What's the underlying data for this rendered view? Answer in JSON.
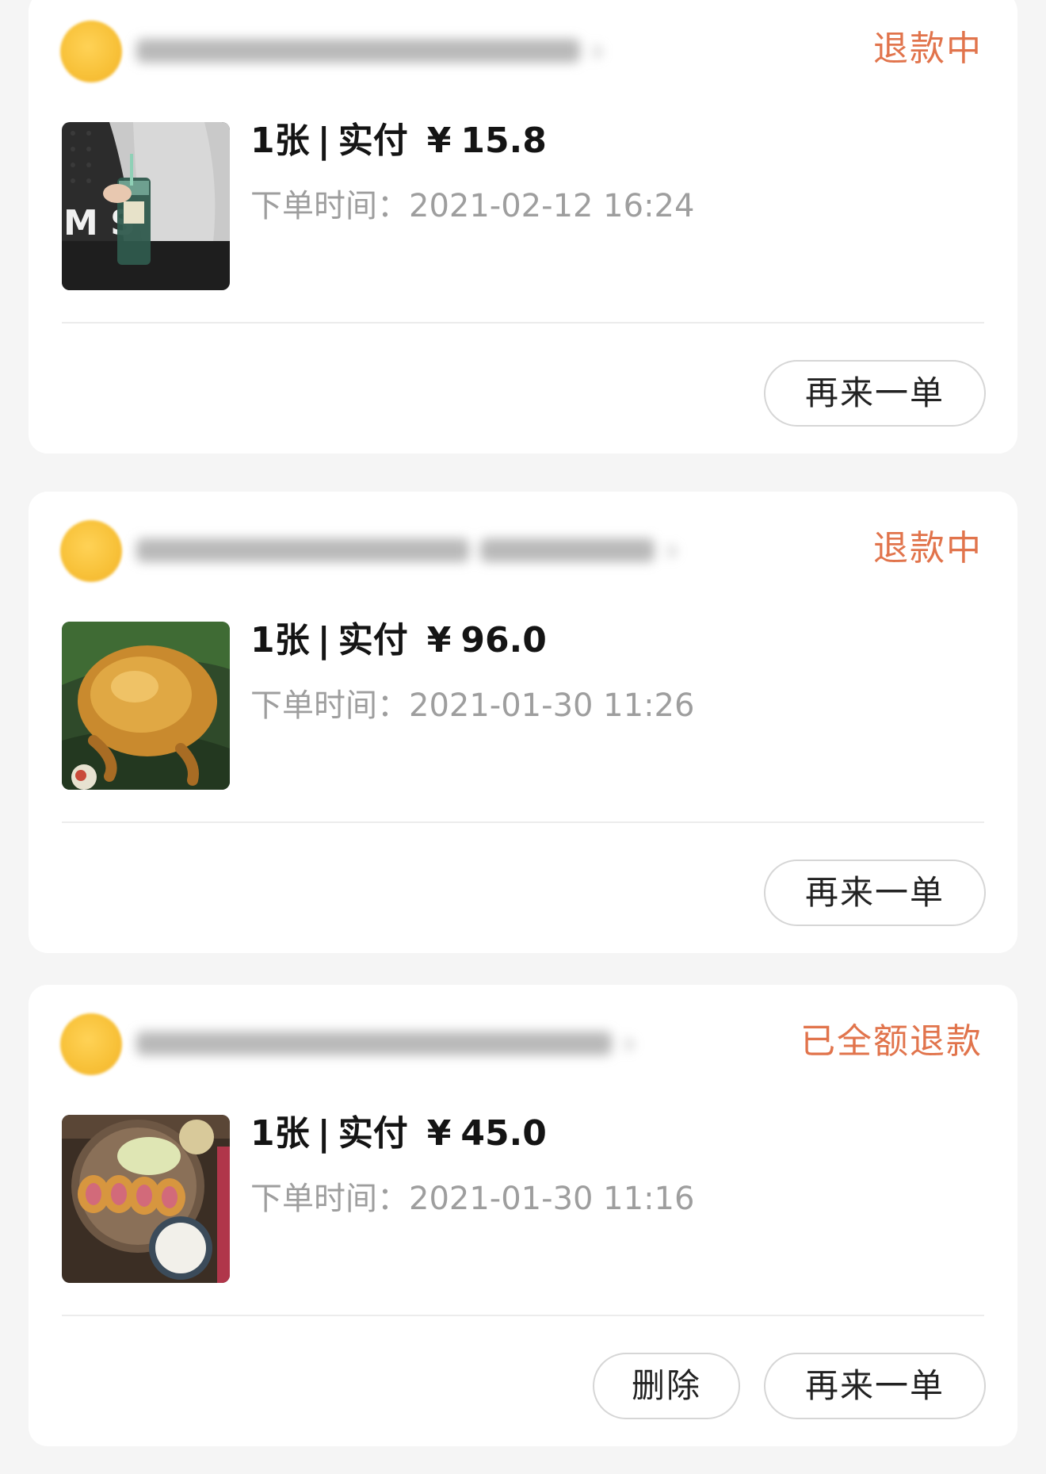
{
  "orders": [
    {
      "status": "退款中",
      "quantity": "1张",
      "separator": "|",
      "paid_label": "实付",
      "currency": "¥",
      "amount": "15.8",
      "time_label": "下单时间：",
      "order_time": "2021-02-12 16:24",
      "reorder_label": "再来一单",
      "status_color": "#e1744c"
    },
    {
      "status": "退款中",
      "quantity": "1张",
      "separator": "|",
      "paid_label": "实付",
      "currency": "¥",
      "amount": "96.0",
      "time_label": "下单时间：",
      "order_time": "2021-01-30 11:26",
      "reorder_label": "再来一单",
      "status_color": "#e1744c"
    },
    {
      "status": "已全额退款",
      "quantity": "1张",
      "separator": "|",
      "paid_label": "实付",
      "currency": "¥",
      "amount": "45.0",
      "time_label": "下单时间：",
      "order_time": "2021-01-30 11:16",
      "delete_label": "删除",
      "reorder_label": "再来一单",
      "status_color": "#e1744c"
    }
  ]
}
